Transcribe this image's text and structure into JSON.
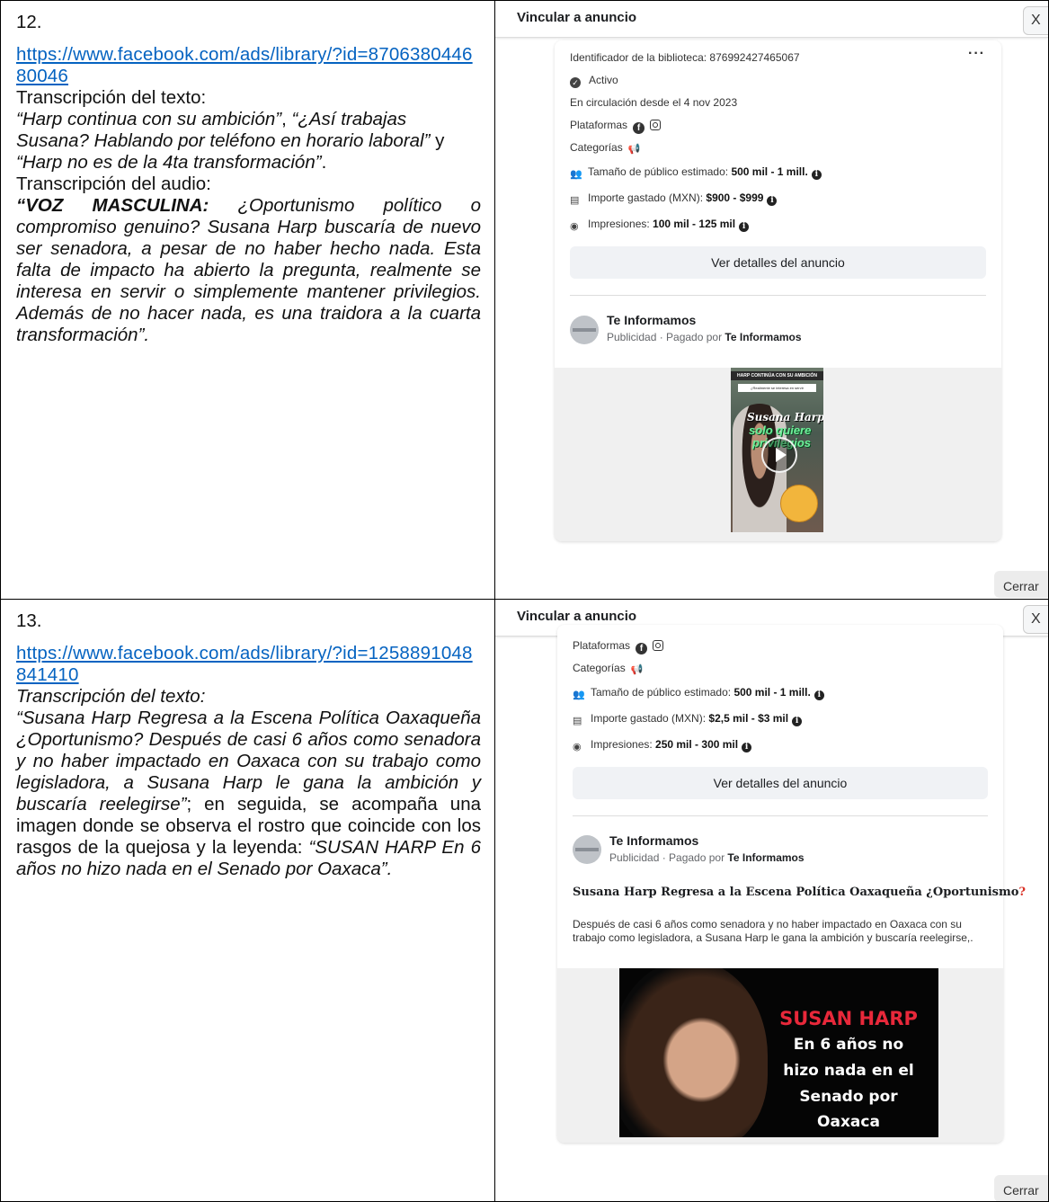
{
  "row12": {
    "number": "12.",
    "url": "https://www.facebook.com/ads/library/?id=870638044680046",
    "text_label": "Transcripción del texto:",
    "text_quote_1": "“Harp continua con su ambición”",
    "comma": ", ",
    "text_quote_2": "“¿Así trabajas Susana? Hablando por teléfono en horario laboral”",
    "y": " y ",
    "text_quote_3": "“Harp no es de la 4ta transformación”",
    "period": ".",
    "audio_label": "Transcripción del audio:",
    "audio_speaker": "“VOZ MASCULINA:",
    "audio_text": " ¿Oportunismo político o compromiso genuino? Susana Harp buscaría de nuevo ser senadora, a pesar de no haber hecho nada. Esta falta de impacto ha abierto la pregunta, realmente se interesa en servir o simplemente mantener privilegios. Además de no hacer nada, es una traidora a la cuarta transformación”.",
    "modal": {
      "title": "Vincular a anuncio",
      "close_glyph": "X",
      "library_id": "Identificador de la biblioteca: 876992427465067",
      "more": "···",
      "status": "Activo",
      "since": "En circulación desde el 4 nov 2023",
      "platforms": "Plataformas",
      "categories": "Categorías",
      "audience_label": "Tamaño de público estimado: ",
      "audience_value": "500 mil - 1 mill.",
      "spend_label": "Importe gastado (MXN): ",
      "spend_value": "$900 - $999",
      "impressions_label": "Impresiones: ",
      "impressions_value": "100 mil - 125 mil",
      "details_button": "Ver detalles del anuncio",
      "page_name": "Te Informamos",
      "sponsored": "Publicidad · Pagado por ",
      "sponsored_by": "Te Informamos",
      "close_button": "Cerrar",
      "video_banner": "HARP CONTINÚA CON SU AMBICIÓN",
      "video_subbanner": "¿Realmente se interesa en servir",
      "video_line1": "Susana Harp",
      "video_line2": "solo quiere",
      "video_line3": "privilegios"
    }
  },
  "row13": {
    "number": "13.",
    "url": "https://www.facebook.com/ads/library/?id=1258891048841410",
    "text_label": "Transcripción del texto:",
    "text_quote": "“Susana Harp Regresa a la Escena Política Oaxaqueña ¿Oportunismo? Después de casi 6 años como senadora y no haber impactado en Oaxaca con su trabajo como legisladora, a Susana Harp le gana la ambición y buscaría reelegirse”",
    "text_middle": "; en seguida, se acompaña una imagen donde se observa el rostro que coincide con los rasgos de la quejosa y la leyenda: ",
    "text_quote_2": "“SUSAN HARP En 6 años no hizo nada en el Senado por Oaxaca”.",
    "modal": {
      "title": "Vincular a anuncio",
      "close_glyph": "X",
      "platforms": "Plataformas",
      "categories": "Categorías",
      "audience_label": "Tamaño de público estimado: ",
      "audience_value": "500 mil - 1 mill.",
      "spend_label": "Importe gastado (MXN): ",
      "spend_value": "$2,5 mil - $3 mil",
      "impressions_label": "Impresiones: ",
      "impressions_value": "250 mil - 300 mil",
      "details_button": "Ver detalles del anuncio",
      "page_name": "Te Informamos",
      "sponsored": "Publicidad · Pagado por ",
      "sponsored_by": "Te Informamos",
      "ad_title": "Susana Harp Regresa a la Escena Política Oaxaqueña ¿Oportunismo",
      "ad_body": "Después de casi 6 años como senadora y no haber impactado en Oaxaca con su trabajo como legisladora, a Susana Harp le gana la ambición y buscaría reelegirse,.",
      "image_name": "SUSAN HARP",
      "image_line1": "En 6 años no",
      "image_line2": "hizo nada en el",
      "image_line3": "Senado por",
      "image_line4": "Oaxaca",
      "close_button": "Cerrar"
    }
  },
  "colors": {
    "link": "#0563c1",
    "fb_gray": "#f0f2f5",
    "image_red": "#e8283a"
  }
}
